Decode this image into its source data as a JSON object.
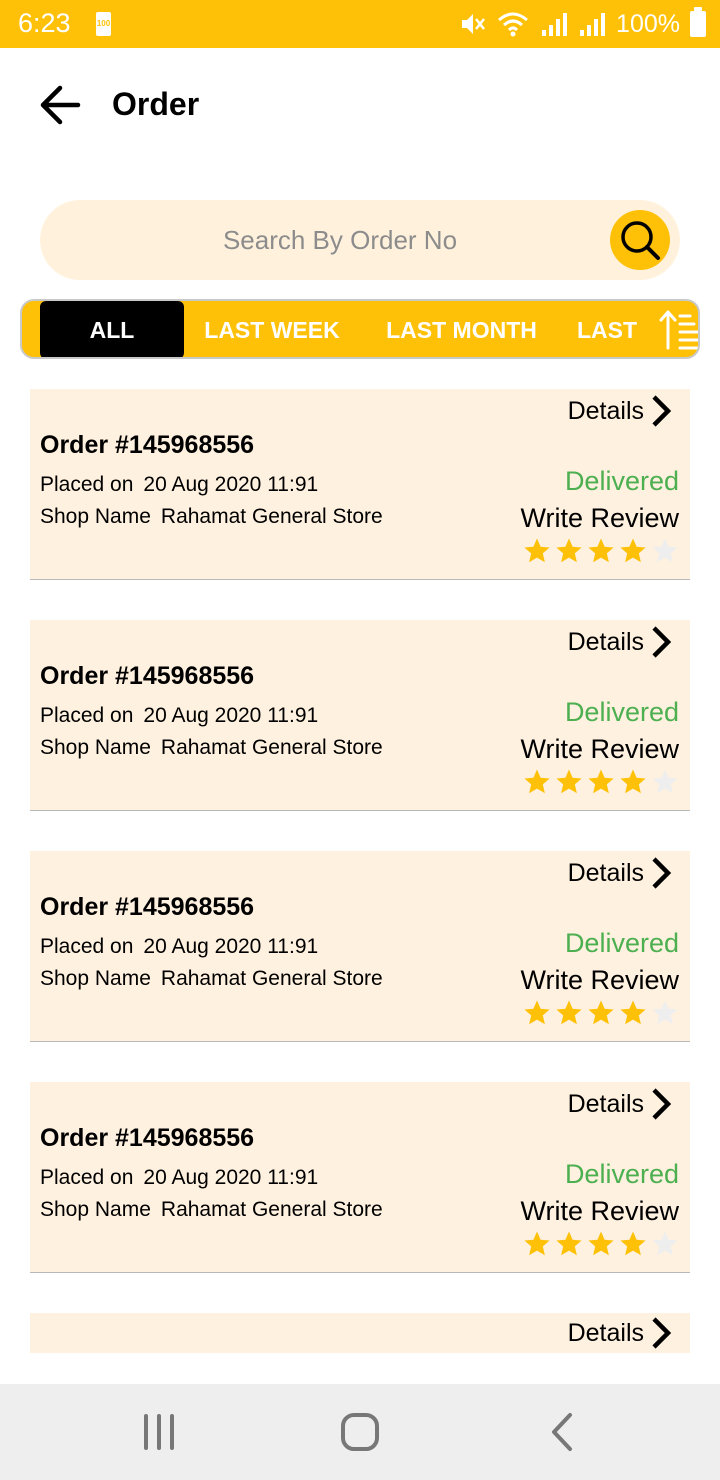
{
  "status_bar": {
    "time": "6:23",
    "battery_small": "100",
    "battery_percent": "100%"
  },
  "header": {
    "title": "Order"
  },
  "search": {
    "placeholder": "Search By Order No"
  },
  "filter_tabs": [
    "ALL",
    "LAST WEEK",
    "LAST MONTH",
    "LAST"
  ],
  "orders": [
    {
      "details_label": "Details",
      "order_number": "Order #145968556",
      "placed_label": "Placed on",
      "placed_value": "20 Aug 2020 11:91",
      "shop_label": "Shop Name",
      "shop_value": "Rahamat General Store",
      "status": "Delivered",
      "review_label": "Write Review",
      "rating": 4,
      "rating_max": 5
    },
    {
      "details_label": "Details",
      "order_number": "Order #145968556",
      "placed_label": "Placed on",
      "placed_value": "20 Aug 2020 11:91",
      "shop_label": "Shop Name",
      "shop_value": "Rahamat General Store",
      "status": "Delivered",
      "review_label": "Write Review",
      "rating": 4,
      "rating_max": 5
    },
    {
      "details_label": "Details",
      "order_number": "Order #145968556",
      "placed_label": "Placed on",
      "placed_value": "20 Aug 2020 11:91",
      "shop_label": "Shop Name",
      "shop_value": "Rahamat General Store",
      "status": "Delivered",
      "review_label": "Write Review",
      "rating": 4,
      "rating_max": 5
    },
    {
      "details_label": "Details",
      "order_number": "Order #145968556",
      "placed_label": "Placed on",
      "placed_value": "20 Aug 2020 11:91",
      "shop_label": "Shop Name",
      "shop_value": "Rahamat General Store",
      "status": "Delivered",
      "review_label": "Write Review",
      "rating": 4,
      "rating_max": 5
    },
    {
      "details_label": "Details"
    }
  ],
  "colors": {
    "accent": "#FFC107",
    "card_background": "#FFF1DF",
    "delivered": "#4CAF50"
  },
  "icons": {
    "back": "arrow-left-icon",
    "search": "magnifier-icon",
    "sort": "sort-ascending-icon",
    "details": "chevron-right-icon",
    "rating": "star-icon",
    "nav": [
      "recent-apps-icon",
      "home-icon",
      "back-icon"
    ]
  }
}
